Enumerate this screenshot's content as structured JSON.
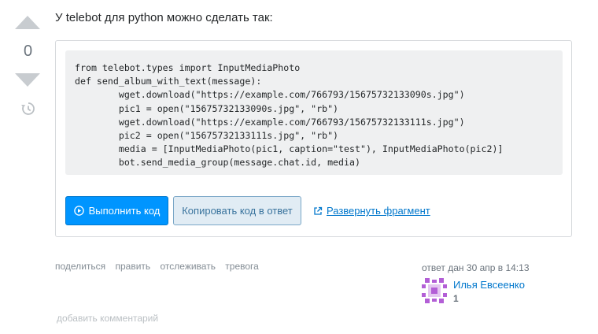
{
  "vote": {
    "count": "0"
  },
  "post": {
    "intro_text": "У telebot для python можно сделать так:",
    "code": "from telebot.types import InputMediaPhoto\ndef send_album_with_text(message):\n        wget.download(\"https://example.com/766793/15675732133090s.jpg\")\n        pic1 = open(\"15675732133090s.jpg\", \"rb\")\n        wget.download(\"https://example.com/766793/15675732133111s.jpg\")\n        pic2 = open(\"15675732133111s.jpg\", \"rb\")\n        media = [InputMediaPhoto(pic1, caption=\"test\"), InputMediaPhoto(pic2)]\n        bot.send_media_group(message.chat.id, media)"
  },
  "snippet": {
    "run_label": "Выполнить код",
    "copy_label": "Копировать код в ответ",
    "expand_label": "Развернуть фрагмент"
  },
  "post_menu": {
    "share": "поделиться",
    "edit": "править",
    "follow": "отслеживать",
    "flag": "тревога"
  },
  "user": {
    "action_time": "ответ дан 30 апр в 14:13",
    "name": "Илья Евсеенко",
    "reputation": "1"
  },
  "comments": {
    "add_label": "добавить комментарий"
  },
  "colors": {
    "accent": "#0095ff",
    "link": "#0077cc",
    "code_bg": "#eff0f1",
    "vote_arrow": "#c8ccd0",
    "avatar": "#b35fd6"
  },
  "icons": {
    "vote_up": "arrow-up-icon",
    "vote_down": "arrow-down-icon",
    "history": "history-icon",
    "run": "play-icon",
    "expand": "external-link-icon"
  }
}
